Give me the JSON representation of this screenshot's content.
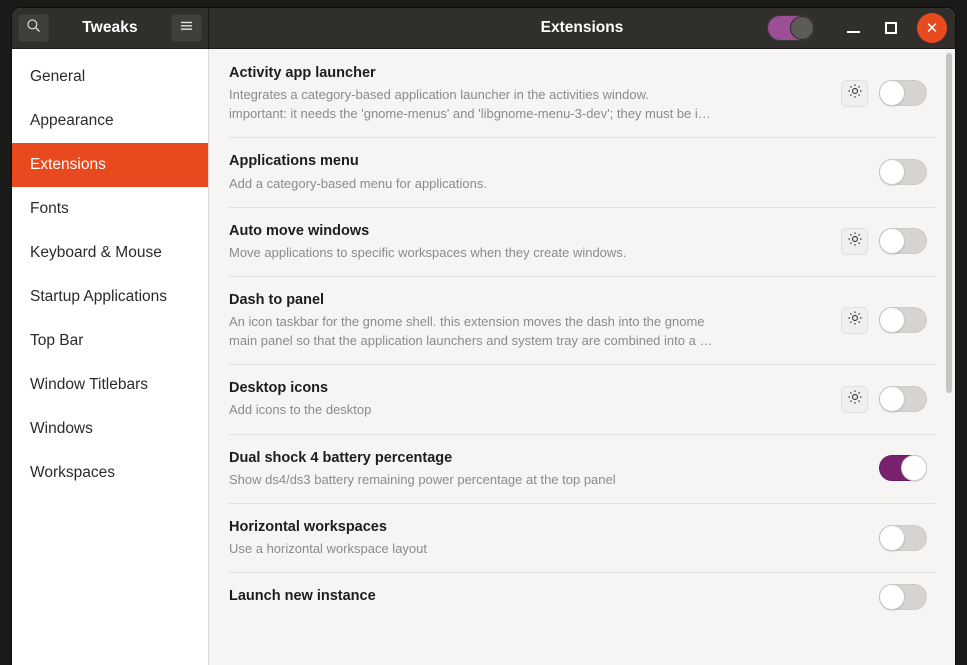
{
  "window": {
    "app_title": "Tweaks",
    "page_title": "Extensions",
    "search_icon": "search-icon",
    "menu_icon": "hamburger-menu-icon",
    "global_toggle_state": "on",
    "controls": {
      "minimize": "minimize-icon",
      "maximize": "maximize-icon",
      "close": "✕"
    }
  },
  "sidebar": {
    "items": [
      {
        "label": "General",
        "selected": false
      },
      {
        "label": "Appearance",
        "selected": false
      },
      {
        "label": "Extensions",
        "selected": true
      },
      {
        "label": "Fonts",
        "selected": false
      },
      {
        "label": "Keyboard & Mouse",
        "selected": false
      },
      {
        "label": "Startup Applications",
        "selected": false
      },
      {
        "label": "Top Bar",
        "selected": false
      },
      {
        "label": "Window Titlebars",
        "selected": false
      },
      {
        "label": "Windows",
        "selected": false
      },
      {
        "label": "Workspaces",
        "selected": false
      }
    ]
  },
  "extensions": [
    {
      "name": "Activity app launcher",
      "description": "Integrates a category-based application launcher in the activities window.\nimportant: it needs the 'gnome-menus' and 'libgnome-menu-3-dev'; they must be i…",
      "has_settings": true,
      "enabled": false
    },
    {
      "name": "Applications menu",
      "description": "Add a category-based menu for applications.",
      "has_settings": false,
      "enabled": false
    },
    {
      "name": "Auto move windows",
      "description": "Move applications to specific workspaces when they create windows.",
      "has_settings": true,
      "enabled": false
    },
    {
      "name": "Dash to panel",
      "description": "An icon taskbar for the gnome shell. this extension moves the dash into the gnome\nmain panel so that the application launchers and system tray are combined into a …",
      "has_settings": true,
      "enabled": false
    },
    {
      "name": "Desktop icons",
      "description": "Add icons to the desktop",
      "has_settings": true,
      "enabled": false
    },
    {
      "name": "Dual shock 4 battery percentage",
      "description": "Show ds4/ds3 battery remaining power percentage at the top panel",
      "has_settings": false,
      "enabled": true
    },
    {
      "name": "Horizontal workspaces",
      "description": "Use a horizontal workspace layout",
      "has_settings": false,
      "enabled": false
    },
    {
      "name": "Launch new instance",
      "description": "",
      "has_settings": false,
      "enabled": false
    }
  ],
  "colors": {
    "accent_orange": "#e8491f",
    "toggle_purple": "#77216f",
    "header_bg": "#302f2c",
    "content_bg": "#f6f5f4"
  }
}
